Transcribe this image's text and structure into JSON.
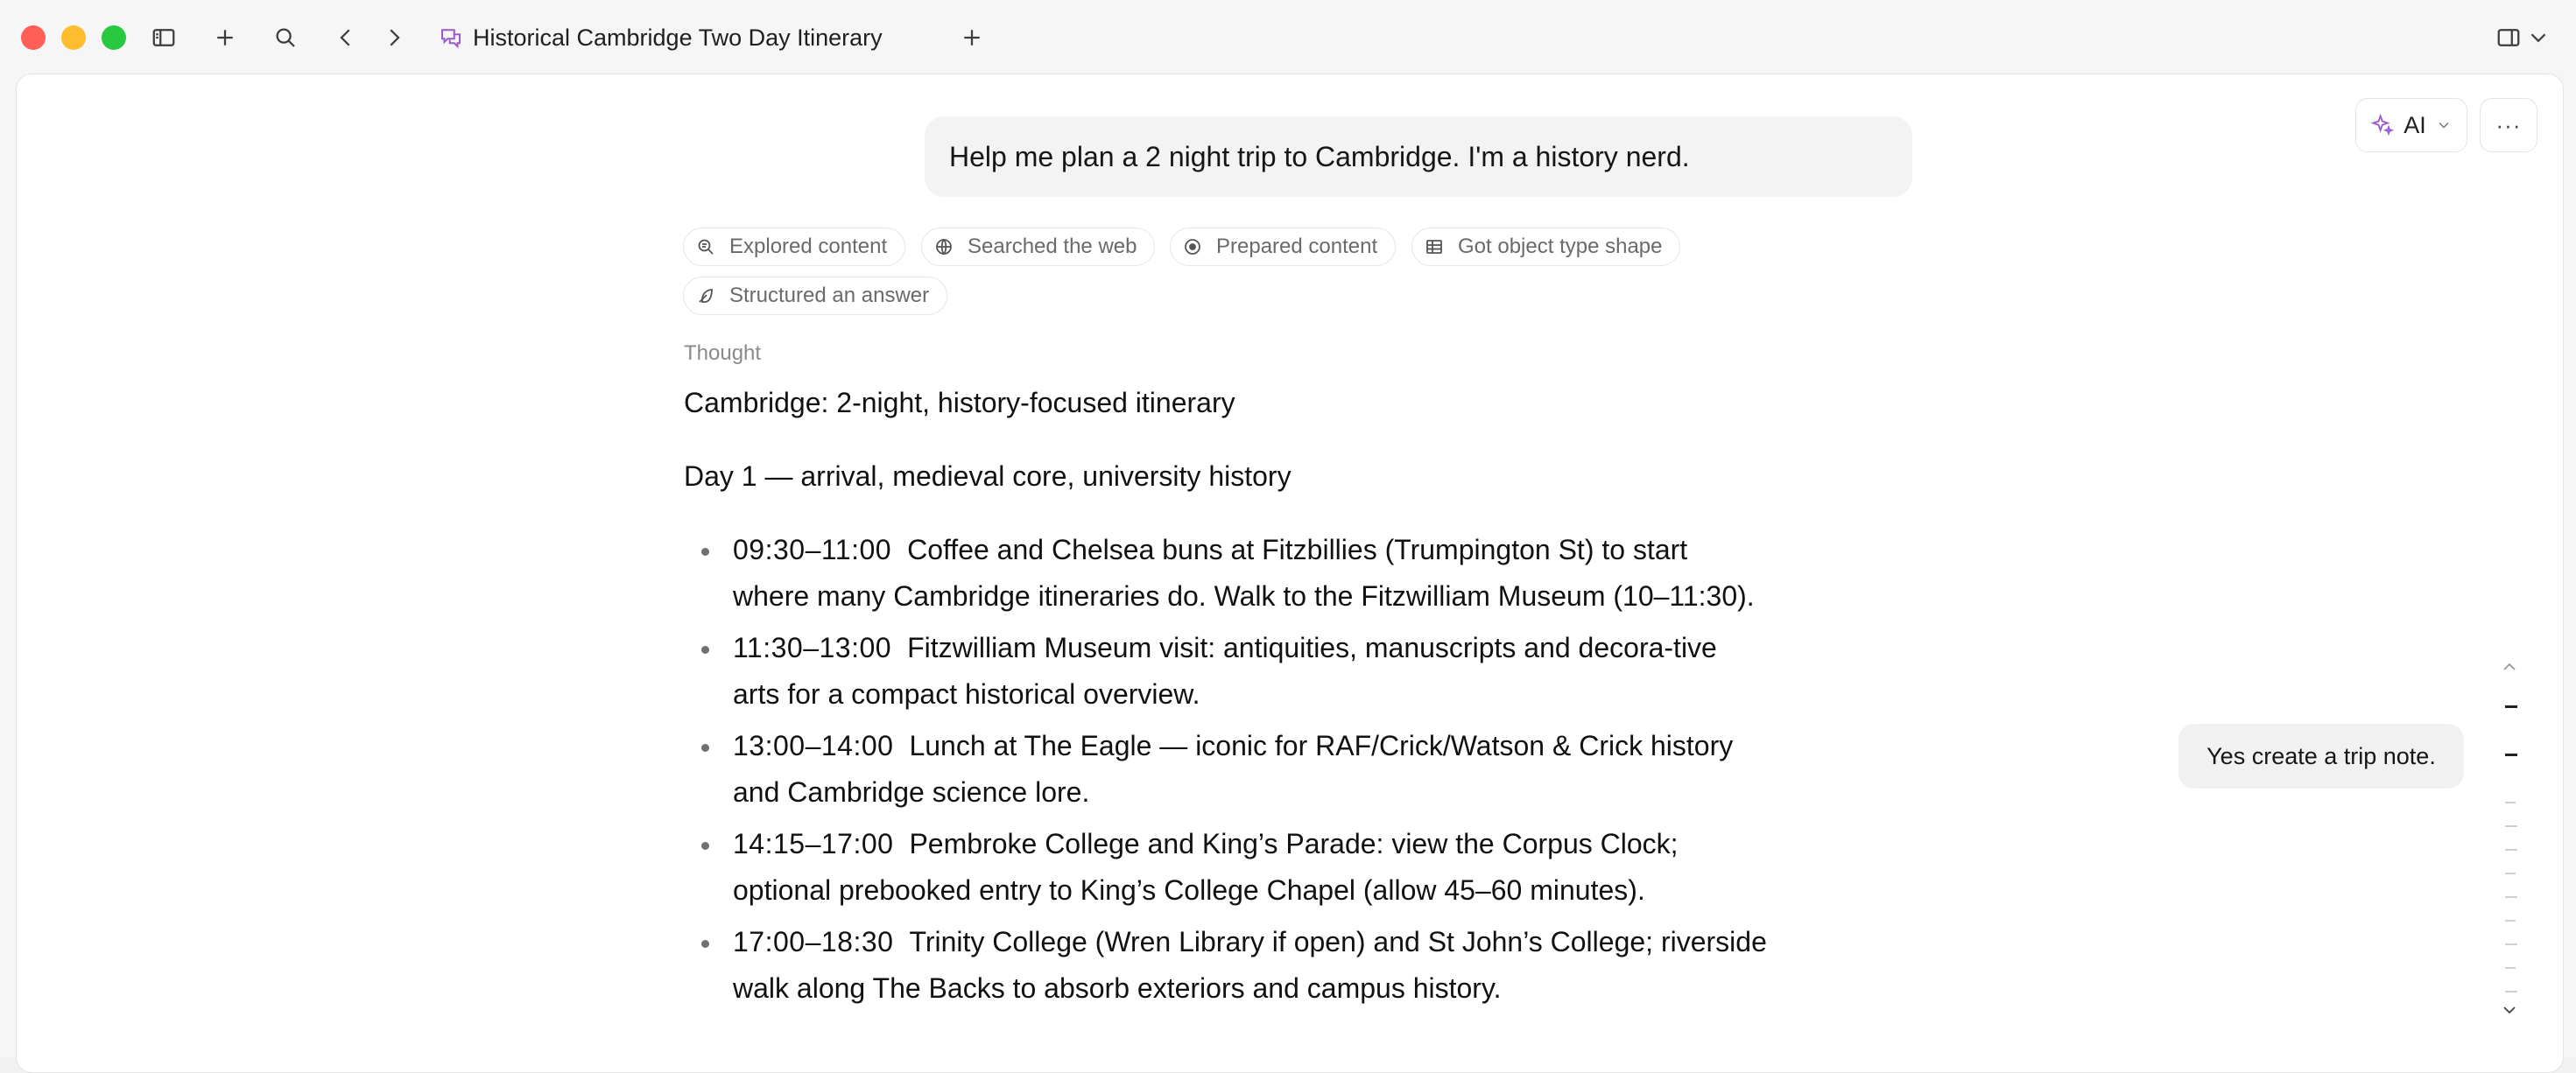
{
  "window": {
    "title": "Historical Cambridge Two Day Itinerary"
  },
  "toolbar": {
    "icons": [
      "close-dot",
      "minimize-dot",
      "zoom-dot",
      "sidebar-icon",
      "plus-icon",
      "search-icon",
      "chevron-left-icon",
      "chevron-right-icon",
      "chat-icon",
      "plus-icon",
      "split-view-icon",
      "chevron-down-icon"
    ],
    "colors": {
      "close": "#ff5f57",
      "minimize": "#febc2e",
      "zoom": "#28c840"
    }
  },
  "header_actions": {
    "ai_label": "AI",
    "more_label": "···"
  },
  "conversation": {
    "user_message": "Help me plan a 2 night trip to Cambridge. I'm a history nerd.",
    "steps": [
      {
        "label": "Explored content",
        "icon": "search-doc-icon"
      },
      {
        "label": "Searched the web",
        "icon": "globe-icon"
      },
      {
        "label": "Prepared content",
        "icon": "target-icon"
      },
      {
        "label": "Got object type shape",
        "icon": "table-icon"
      },
      {
        "label": "Structured an answer",
        "icon": "feather-icon"
      }
    ],
    "thought_label": "Thought",
    "heading": "Cambridge: 2-night, history-focused itinerary",
    "day_title": "Day 1 — arrival, medieval core, university history",
    "items": [
      {
        "time": "09:30–11:00",
        "text": "Coffee and Chelsea buns at Fitzbillies (Trumpington St) to start where many Cambridge itineraries do. Walk to the Fitzwilliam Museum (10–11:30)."
      },
      {
        "time": "11:30–13:00",
        "text": "Fitzwilliam Museum visit: antiquities, manuscripts and decora-tive arts for a compact historical overview."
      },
      {
        "time": "13:00–14:00",
        "text": "Lunch at The Eagle — iconic for RAF/Crick/Watson & Crick history and Cambridge science lore."
      },
      {
        "time": "14:15–17:00",
        "text": "Pembroke College and King’s Parade: view the Corpus Clock; optional prebooked entry to King’s College Chapel (allow 45–60 minutes)."
      },
      {
        "time": "17:00–18:30",
        "text": "Trinity College (Wren Library if open) and St John’s College; riverside walk along The Backs to absorb exteriors and campus history."
      }
    ]
  },
  "side_suggestion": "Yes create a trip note."
}
